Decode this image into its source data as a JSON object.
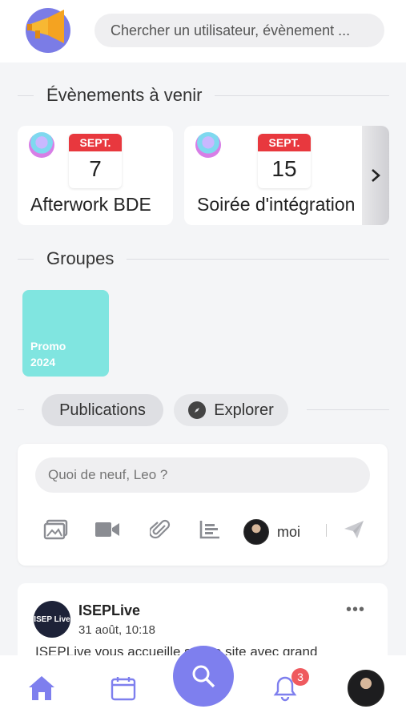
{
  "header": {
    "search_placeholder": "Chercher un utilisateur, évènement ..."
  },
  "events_section": {
    "title": "Évènements à venir",
    "events": [
      {
        "month": "SEPT.",
        "day": "7",
        "name": "Afterwork BDE"
      },
      {
        "month": "SEPT.",
        "day": "15",
        "name": "Soirée d'intégration"
      }
    ],
    "next_icon": "chevron-right-icon"
  },
  "groups_section": {
    "title": "Groupes",
    "groups": [
      {
        "name": "Promo 2024",
        "color": "#80e5e0"
      }
    ]
  },
  "tabs": {
    "publications": "Publications",
    "explorer": "Explorer"
  },
  "composer": {
    "placeholder": "Quoi de neuf, Leo ?",
    "audience_label": "moi",
    "icons": [
      "image-icon",
      "video-icon",
      "attachment-icon",
      "poll-icon",
      "send-icon"
    ]
  },
  "post": {
    "author": "ISEPLive",
    "avatar_text": "ISEP Live",
    "time": "31 août, 10:18",
    "preview": "ISEPLive vous accueille sur ce site avec grand"
  },
  "bottom_nav": {
    "notification_count": "3",
    "accent_color": "#7e7fee"
  }
}
